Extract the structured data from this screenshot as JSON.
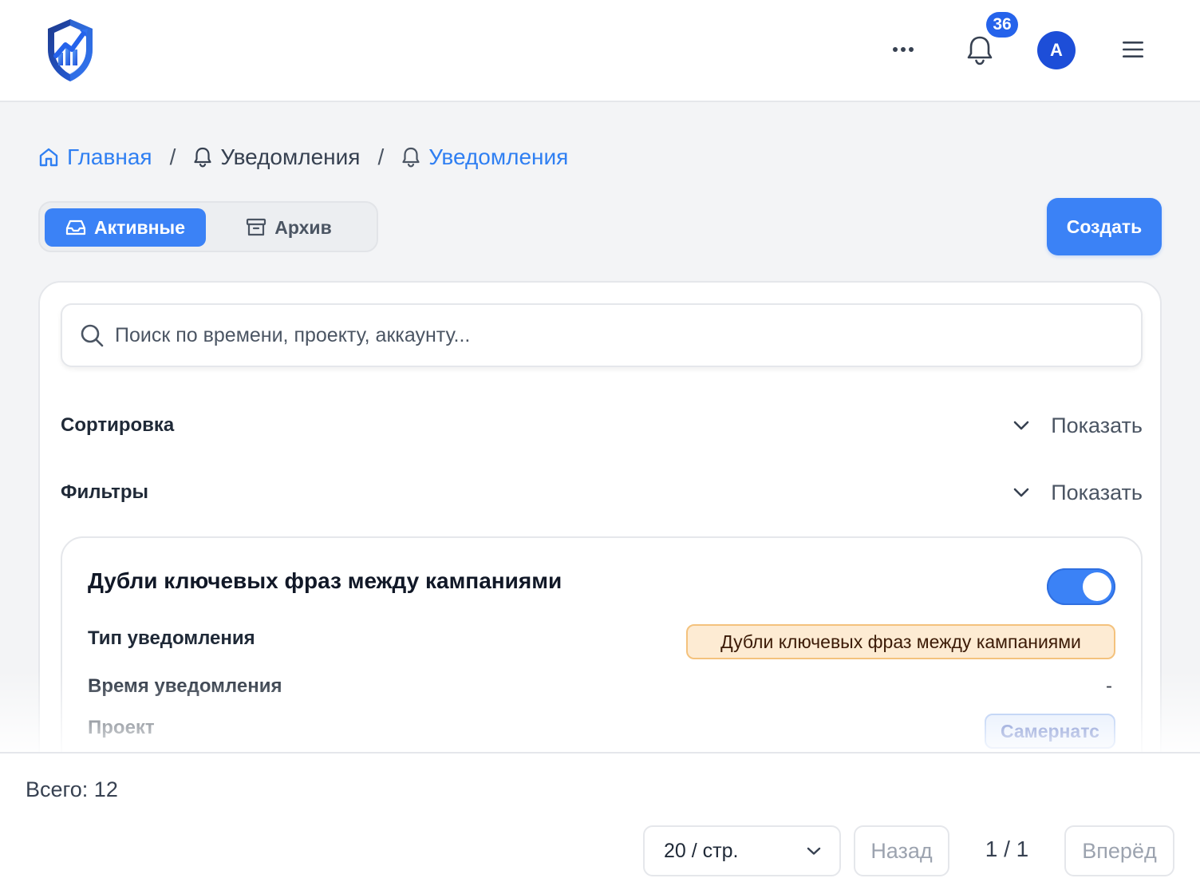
{
  "header": {
    "notifications_badge": "36",
    "avatar_initial": "A"
  },
  "breadcrumb": {
    "home": "Главная",
    "parent": "Уведомления",
    "current": "Уведомления"
  },
  "tabs": {
    "active": "Активные",
    "archive": "Архив"
  },
  "toolbar": {
    "create_label": "Создать"
  },
  "search": {
    "placeholder": "Поиск по времени, проекту, аккаунту..."
  },
  "sort": {
    "title": "Сортировка",
    "toggle_label": "Показать"
  },
  "filters": {
    "title": "Фильтры",
    "toggle_label": "Показать"
  },
  "notification": {
    "title": "Дубли ключевых фраз между кампаниями",
    "enabled": true,
    "fields": {
      "type_label": "Тип уведомления",
      "type_value": "Дубли ключевых фраз между кампаниями",
      "time_label": "Время уведомления",
      "time_value": "-",
      "project_label": "Проект",
      "project_value": "Самернатс"
    }
  },
  "footer": {
    "total": "Всего: 12",
    "per_page": "20 / стр.",
    "prev_label": "Назад",
    "page_indicator": "1 / 1",
    "next_label": "Вперёд"
  },
  "colors": {
    "primary": "#3b82f6",
    "link": "#2f7ff2",
    "badge": "#2563eb",
    "tag_orange_bg": "#fdebd3",
    "tag_blue_bg": "#dbe7fb"
  },
  "icons": {
    "logo": "shield-chart-logo",
    "more": "more-horizontal-icon",
    "bell": "bell-icon",
    "menu": "hamburger-menu-icon",
    "home": "home-icon",
    "inbox": "inbox-icon",
    "archive": "archive-box-icon",
    "search": "search-icon",
    "chevron": "chevron-down-icon"
  }
}
